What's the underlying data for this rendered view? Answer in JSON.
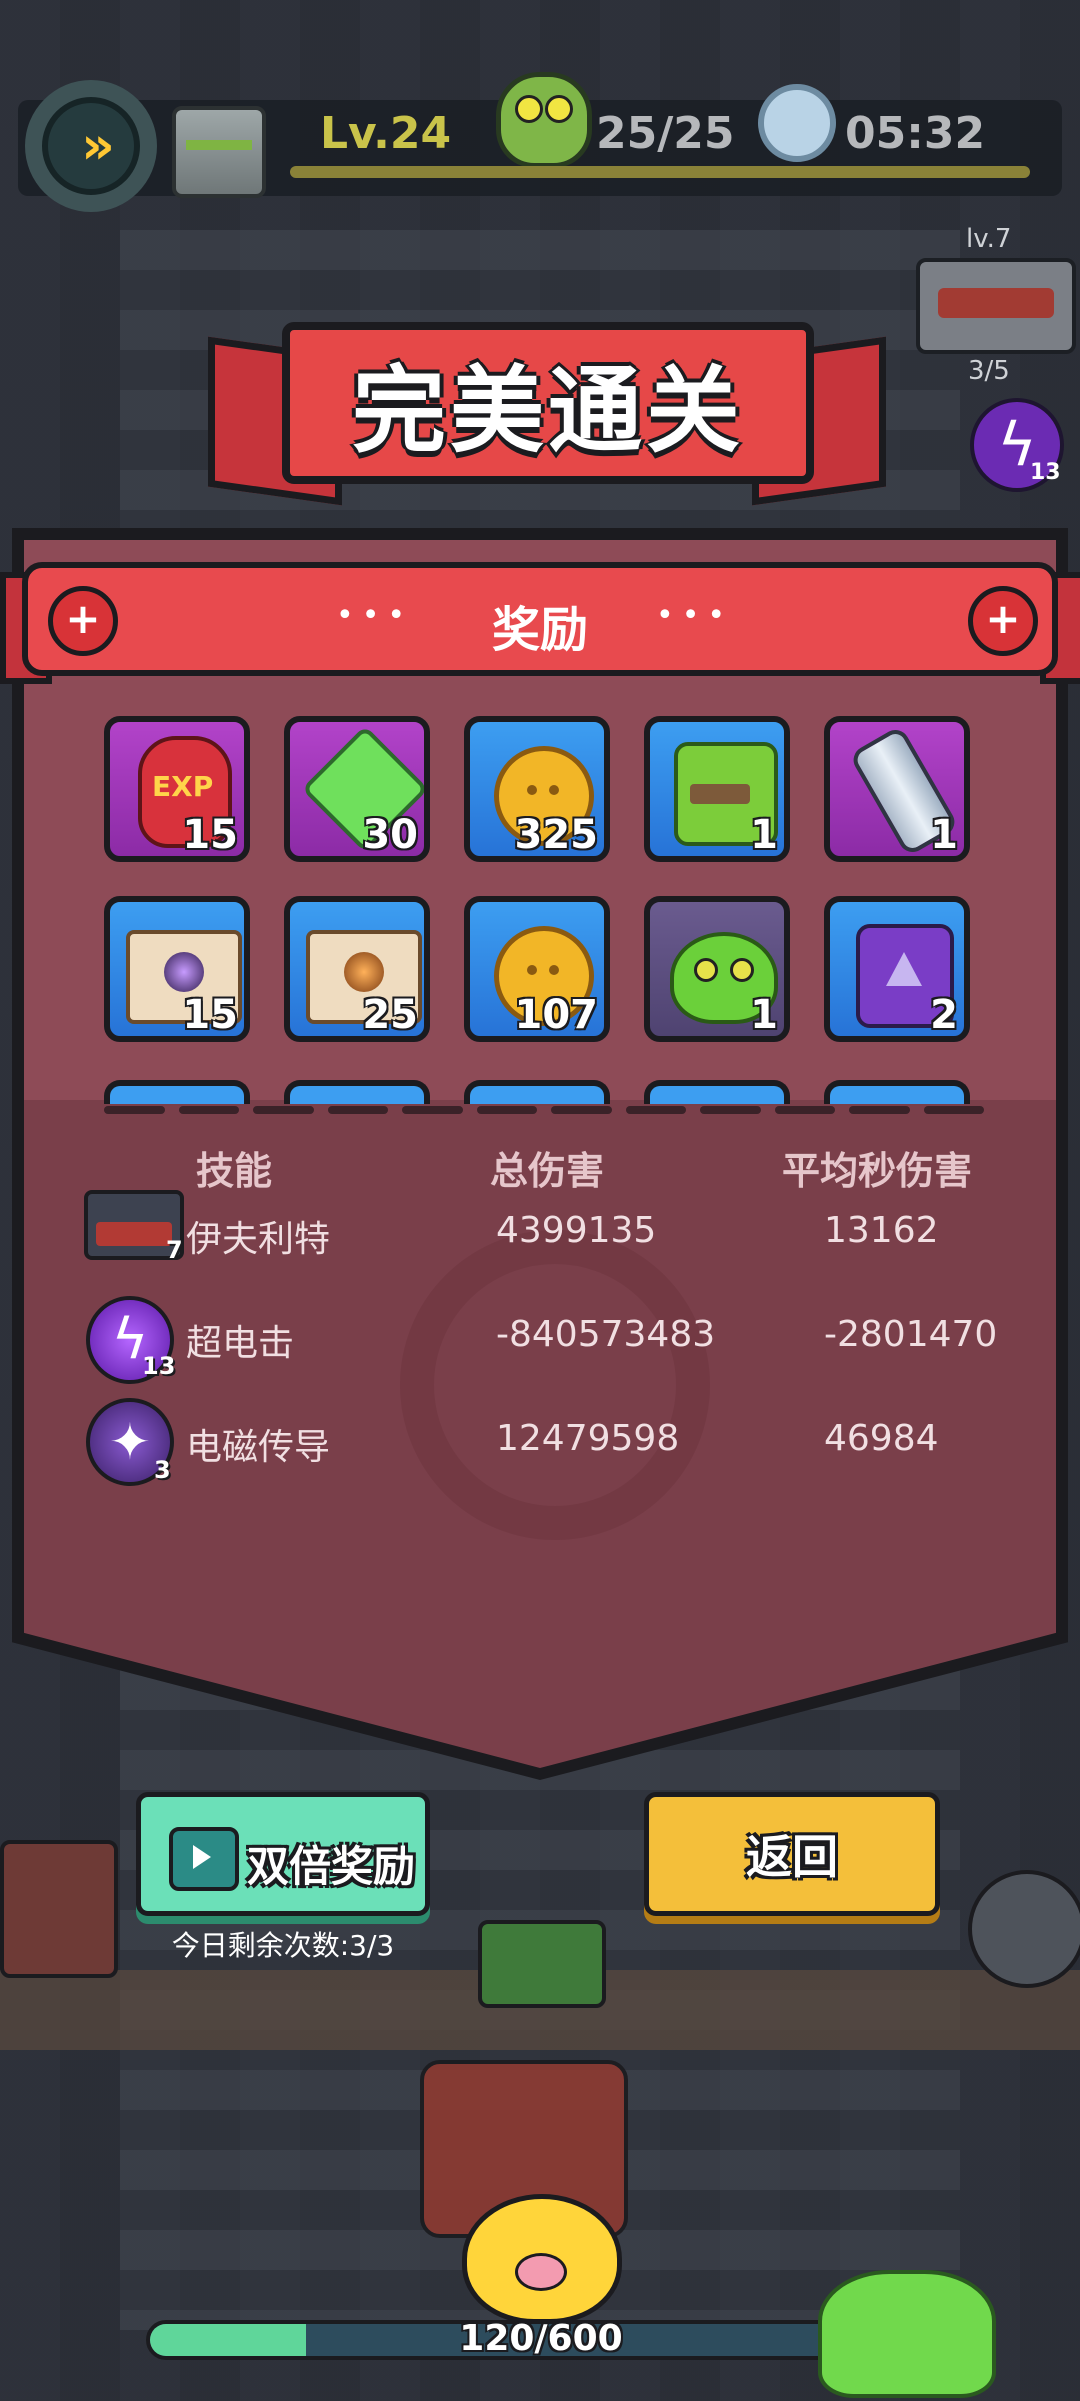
{
  "hud": {
    "level": "Lv.24",
    "kills": "25/25",
    "time": "05:32",
    "speed_icon": "fast-forward-icon"
  },
  "side": {
    "weapon_level": "lv.7",
    "weapon_count": "3/5",
    "orb_count": "13"
  },
  "result": {
    "title": "完美通关",
    "rewards_header": "奖励",
    "header_dots": "•••"
  },
  "rewards": [
    {
      "icon": "exp-potion-icon",
      "count": "15",
      "exp_label": "EXP"
    },
    {
      "icon": "green-gem-icon",
      "count": "30"
    },
    {
      "icon": "gold-coin-icon",
      "count": "325"
    },
    {
      "icon": "puzzle-piece-icon",
      "count": "1"
    },
    {
      "icon": "energy-tube-icon",
      "count": "1"
    },
    {
      "icon": "vortex-scroll-icon",
      "count": "15"
    },
    {
      "icon": "weapon-scroll-icon",
      "count": "25"
    },
    {
      "icon": "gold-coin-icon",
      "count": "107"
    },
    {
      "icon": "slime-icon",
      "count": "1"
    },
    {
      "icon": "chip-icon",
      "count": "2"
    }
  ],
  "stats": {
    "headers": [
      "技能",
      "总伤害",
      "平均秒伤害"
    ],
    "rows": [
      {
        "icon": "weapon-icon",
        "level": "7",
        "name": "伊夫利特",
        "total": "4399135",
        "dps": "13162"
      },
      {
        "icon": "lightning-orb-icon",
        "level": "13",
        "name": "超电击",
        "total": "-840573483",
        "dps": "-2801470"
      },
      {
        "icon": "electromagnetic-orb-icon",
        "level": "3",
        "name": "电磁传导",
        "total": "12479598",
        "dps": "46984"
      }
    ]
  },
  "buttons": {
    "double_reward": "双倍奖励",
    "remaining": "今日剩余次数:3/3",
    "back": "返回"
  },
  "xp": {
    "text": "120/600",
    "fraction": 0.2
  }
}
